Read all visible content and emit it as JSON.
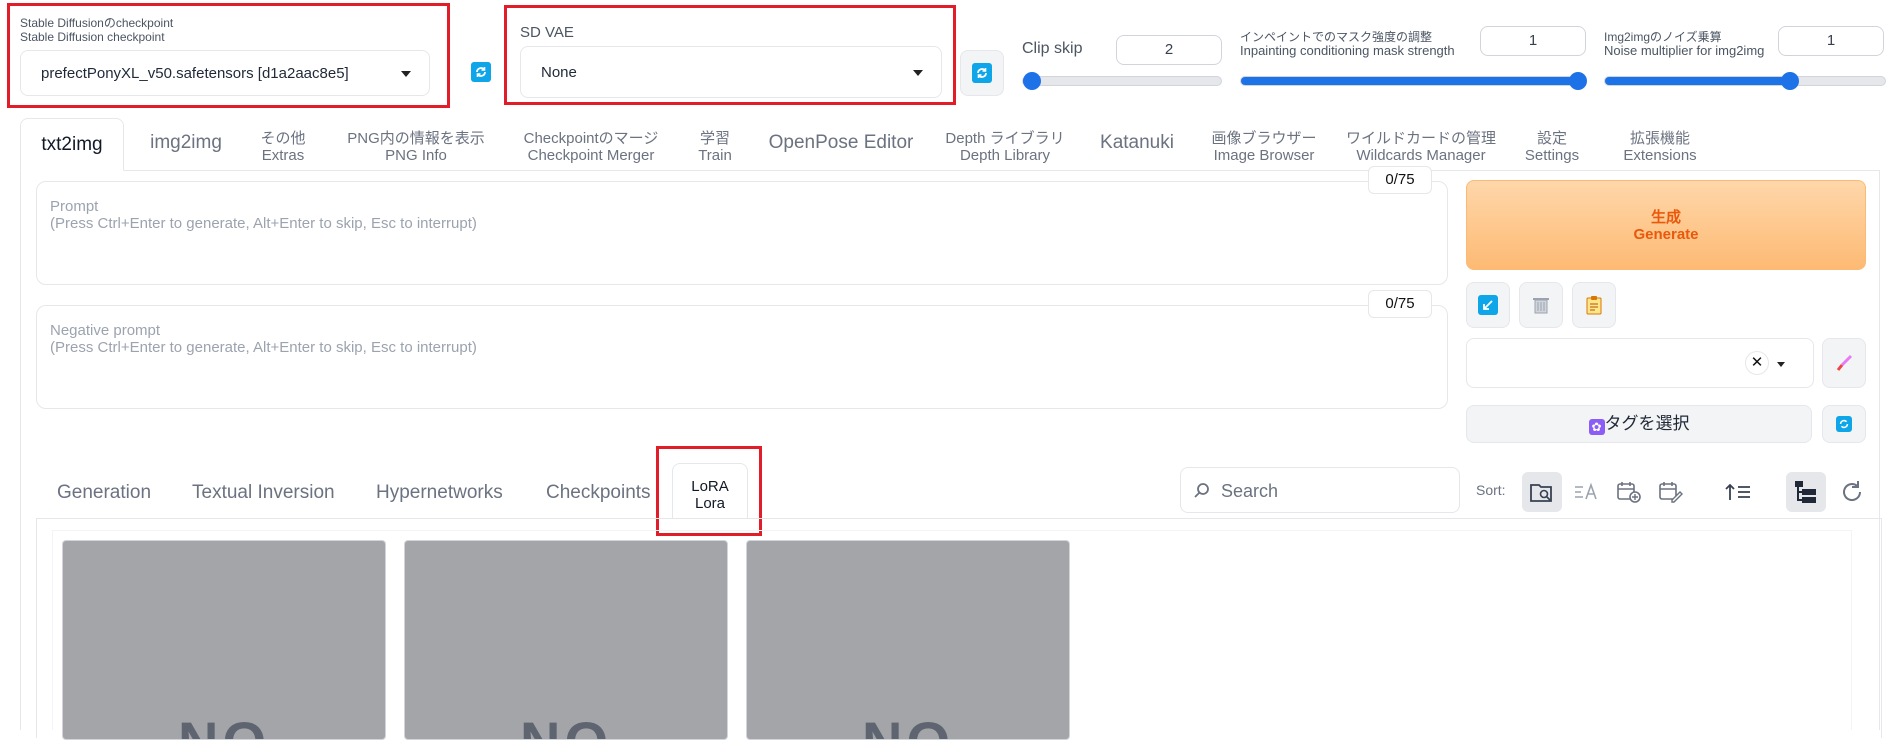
{
  "checkpoint": {
    "label_ja": "Stable Diffusionのcheckpoint",
    "label_en": "Stable Diffusion checkpoint",
    "value": "prefectPonyXL_v50.safetensors [d1a2aac8e5]"
  },
  "vae": {
    "label": "SD VAE",
    "value": "None"
  },
  "clip_skip": {
    "label": "Clip skip",
    "value": "2",
    "fraction": 0.0
  },
  "inpaint_mask": {
    "label_ja": "インペイントでのマスク強度の調整",
    "label_en": "Inpainting conditioning mask strength",
    "value": "1",
    "fraction": 1.0
  },
  "noise_mult": {
    "label_ja": "Img2imgのノイズ乗算",
    "label_en": "Noise multiplier for img2img",
    "value": "1",
    "fraction": 0.6
  },
  "tabs": [
    {
      "l1": "txt2img"
    },
    {
      "l1": "img2img"
    },
    {
      "l1": "その他",
      "l2": "Extras"
    },
    {
      "l1": "PNG内の情報を表示",
      "l2": "PNG Info"
    },
    {
      "l1": "Checkpointのマージ",
      "l2": "Checkpoint Merger"
    },
    {
      "l1": "学習",
      "l2": "Train"
    },
    {
      "l1": "OpenPose Editor"
    },
    {
      "l1": "Depth ライブラリ",
      "l2": "Depth Library"
    },
    {
      "l1": "Katanuki"
    },
    {
      "l1": "画像ブラウザー",
      "l2": "Image Browser"
    },
    {
      "l1": "ワイルドカードの管理",
      "l2": "Wildcards Manager"
    },
    {
      "l1": "設定",
      "l2": "Settings"
    },
    {
      "l1": "拡張機能",
      "l2": "Extensions"
    }
  ],
  "prompt": {
    "label": "Prompt",
    "hint": "(Press Ctrl+Enter to generate, Alt+Enter to skip, Esc to interrupt)",
    "counter": "0/75"
  },
  "negative_prompt": {
    "label": "Negative prompt",
    "hint": "(Press Ctrl+Enter to generate, Alt+Enter to skip, Esc to interrupt)",
    "counter": "0/75"
  },
  "generate": {
    "ja": "生成",
    "en": "Generate"
  },
  "tag_select": {
    "label": "タグを選択"
  },
  "extra_tabs": {
    "generation": "Generation",
    "textual_inversion": "Textual Inversion",
    "hypernetworks": "Hypernetworks",
    "checkpoints": "Checkpoints",
    "lora_l1": "LoRA",
    "lora_l2": "Lora"
  },
  "search": {
    "placeholder": "Search"
  },
  "sort": {
    "label": "Sort:"
  },
  "cards": [
    {
      "placeholder": "NO"
    },
    {
      "placeholder": "NO"
    },
    {
      "placeholder": "NO"
    }
  ],
  "colors": {
    "accent_blue": "#1d72e8",
    "highlight_red": "#e11d2a",
    "generate_orange": "#ea580c",
    "generate_bg": "#fdba74"
  },
  "icons": [
    "refresh-icon",
    "arrow-icon",
    "trash-icon",
    "clipboard-icon",
    "brush-icon",
    "search-icon",
    "folder-search-icon",
    "sort-alpha-icon",
    "calendar-add-icon",
    "calendar-edit-icon",
    "sort-asc-icon",
    "tree-view-icon",
    "reload-icon"
  ]
}
